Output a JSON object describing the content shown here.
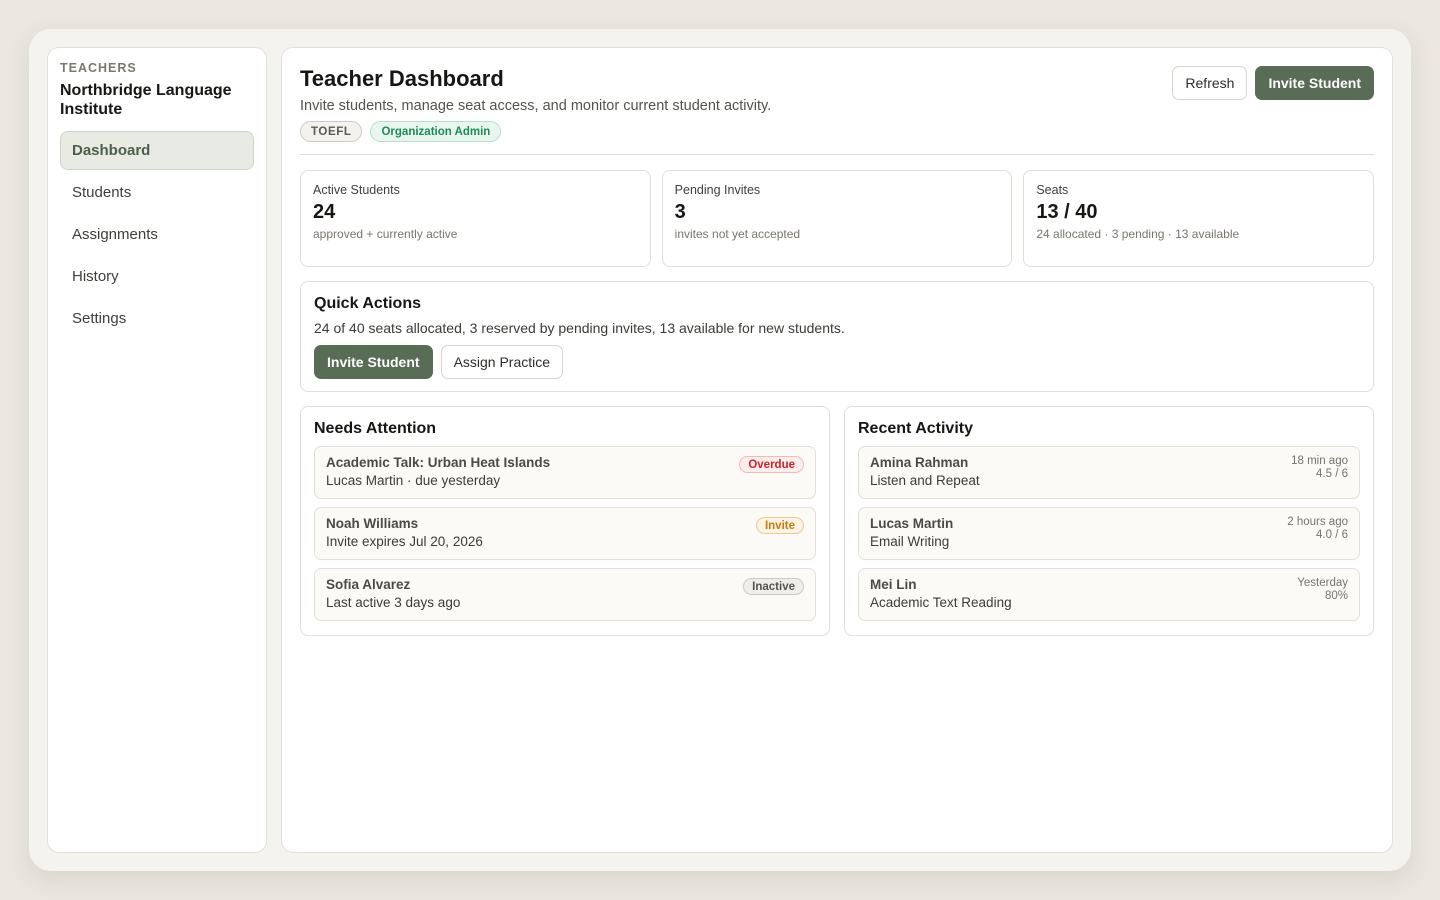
{
  "sidebar": {
    "eyebrow": "TEACHERS",
    "org": "Northbridge Language Institute",
    "items": [
      {
        "label": "Dashboard"
      },
      {
        "label": "Students"
      },
      {
        "label": "Assignments"
      },
      {
        "label": "History"
      },
      {
        "label": "Settings"
      }
    ],
    "active_item": "Dashboard"
  },
  "header": {
    "title": "Teacher Dashboard",
    "subtitle": "Invite students, manage seat access, and monitor current student activity.",
    "tags": {
      "plan": "TOEFL",
      "role": "Organization Admin"
    },
    "refresh_label": "Refresh",
    "invite_label": "Invite Student"
  },
  "stats": [
    {
      "label": "Active Students",
      "value": "24",
      "note": "approved + currently active"
    },
    {
      "label": "Pending Invites",
      "value": "3",
      "note": "invites not yet accepted"
    },
    {
      "label": "Seats",
      "value": "13 / 40",
      "note": "24 allocated · 3 pending · 13 available"
    }
  ],
  "quick_actions": {
    "title": "Quick Actions",
    "description": "24 of 40 seats allocated, 3 reserved by pending invites, 13 available for new students.",
    "invite_label": "Invite Student",
    "assign_label": "Assign Practice"
  },
  "needs_attention": {
    "title": "Needs Attention",
    "items": [
      {
        "title": "Academic Talk: Urban Heat Islands",
        "subtitle": "Lucas Martin · due yesterday",
        "badge": "Overdue"
      },
      {
        "title": "Noah Williams",
        "subtitle": "Invite expires Jul 20, 2026",
        "badge": "Invite"
      },
      {
        "title": "Sofia Alvarez",
        "subtitle": "Last active 3 days ago",
        "badge": "Inactive"
      }
    ]
  },
  "recent_activity": {
    "title": "Recent Activity",
    "items": [
      {
        "name": "Amina Rahman",
        "task": "Listen and Repeat",
        "time": "18 min ago",
        "score": "4.5 / 6"
      },
      {
        "name": "Lucas Martin",
        "task": "Email Writing",
        "time": "2 hours ago",
        "score": "4.0 / 6"
      },
      {
        "name": "Mei Lin",
        "task": "Academic Text Reading",
        "time": "Yesterday",
        "score": "80%"
      }
    ]
  },
  "colors": {
    "accent": "#586c56",
    "overdue": "#c62828",
    "invite": "#c27a12",
    "role_tag": "#1e8a55"
  }
}
